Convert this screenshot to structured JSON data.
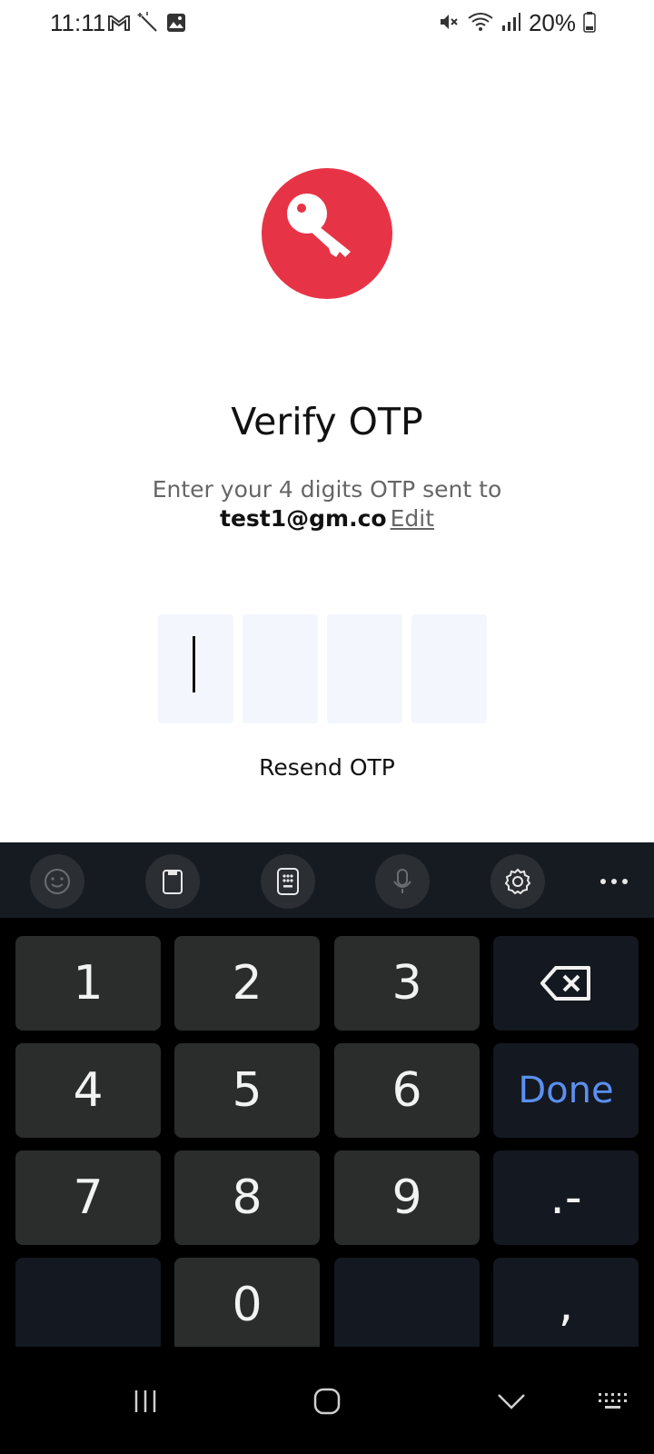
{
  "status_bar": {
    "time": "11:11",
    "battery": "20%",
    "left_icons": [
      "gmail-icon",
      "magic-wand-icon",
      "gallery-icon"
    ],
    "right_icons": [
      "mute-icon",
      "wifi-icon",
      "signal-icon",
      "battery-icon"
    ]
  },
  "hero": {
    "icon": "key-icon",
    "color": "#e63446"
  },
  "title": "Verify OTP",
  "subtitle": "Enter your 4 digits OTP sent to",
  "email": "test1@gm.co",
  "edit_label": "Edit",
  "otp": {
    "length": 4,
    "values": [
      "",
      "",
      "",
      ""
    ],
    "active_index": 0
  },
  "resend_label": "Resend OTP",
  "keyboard": {
    "toolbar": [
      "emoji-icon",
      "clipboard-icon",
      "keypad-icon",
      "mic-icon",
      "settings-icon",
      "more-icon"
    ],
    "keys": {
      "k1": "1",
      "k2": "2",
      "k3": "3",
      "k4": "4",
      "k5": "5",
      "k6": "6",
      "k7": "7",
      "k8": "8",
      "k9": "9",
      "k0": "0",
      "done": "Done",
      "dot_dash": ".-",
      "comma": ","
    },
    "accent_color": "#5b8ff0"
  },
  "navbar": [
    "recents-icon",
    "home-icon",
    "back-icon",
    "keyboard-icon"
  ]
}
